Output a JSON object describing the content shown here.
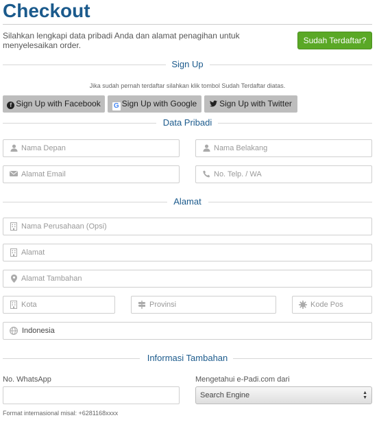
{
  "header": {
    "title": "Checkout",
    "intro": "Silahkan lengkapi data pribadi Anda dan alamat penagihan untuk menyelesaikan order.",
    "registered_button": "Sudah Terdaftar?"
  },
  "signup": {
    "section_title": "Sign Up",
    "hint": "Jika sudah pernah terdaftar silahkan klik tombol Sudah Terdaftar diatas.",
    "facebook_label": "Sign Up with Facebook",
    "google_label": "Sign Up with Google",
    "twitter_label": "Sign Up with Twitter"
  },
  "personal": {
    "section_title": "Data Pribadi",
    "first_name_placeholder": "Nama Depan",
    "last_name_placeholder": "Nama Belakang",
    "email_placeholder": "Alamat Email",
    "phone_placeholder": "No. Telp. / WA"
  },
  "address": {
    "section_title": "Alamat",
    "company_placeholder": "Nama Perusahaan (Opsi)",
    "address_placeholder": "Alamat",
    "address2_placeholder": "Alamat Tambahan",
    "city_placeholder": "Kota",
    "province_placeholder": "Provinsi",
    "postcode_placeholder": "Kode Pos",
    "country_value": "Indonesia"
  },
  "extra": {
    "section_title": "Informasi Tambahan",
    "whatsapp_label": "No. WhatsApp",
    "source_label": "Mengetahui e-Padi.com dari",
    "source_selected": "Search Engine",
    "whatsapp_hint": "Format internasional misal: +6281168xxxx"
  },
  "colors": {
    "title": "#1b5a8c",
    "green_button": "#5aa826",
    "social_button": "#bdbdbd"
  },
  "icons": {
    "user": "user-icon",
    "email": "envelope-icon",
    "phone": "phone-icon",
    "building": "building-icon",
    "location": "map-marker-icon",
    "road": "road-sign-icon",
    "postcode": "gear-icon",
    "globe": "globe-icon"
  }
}
